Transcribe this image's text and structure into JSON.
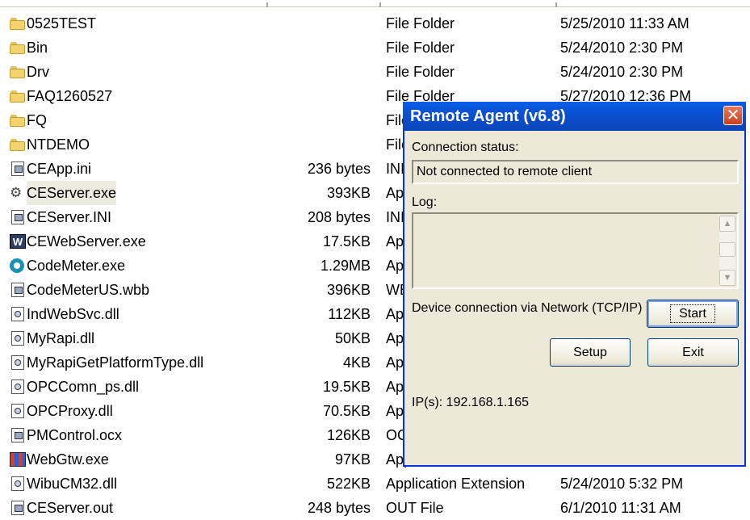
{
  "files": [
    {
      "icon": "folder-icon",
      "name": "0525TEST",
      "size": "",
      "type": "File Folder",
      "date": "5/25/2010 11:33 AM"
    },
    {
      "icon": "folder-icon",
      "name": "Bin",
      "size": "",
      "type": "File Folder",
      "date": "5/24/2010 2:30 PM"
    },
    {
      "icon": "folder-icon",
      "name": "Drv",
      "size": "",
      "type": "File Folder",
      "date": "5/24/2010 2:30 PM"
    },
    {
      "icon": "folder-icon",
      "name": "FAQ1260527",
      "size": "",
      "type": "File Folder",
      "date": "5/27/2010 12:36 PM"
    },
    {
      "icon": "folder-icon",
      "name": "FQ",
      "size": "",
      "type": "File Folder",
      "date": ""
    },
    {
      "icon": "folder-icon",
      "name": "NTDEMO",
      "size": "",
      "type": "File Folder",
      "date": ""
    },
    {
      "icon": "ini-file-icon",
      "name": "CEApp.ini",
      "size": "236 bytes",
      "type": "INI",
      "date": ""
    },
    {
      "icon": "gear-exe-icon",
      "name": "CEServer.exe",
      "size": "393KB",
      "type": "Application",
      "date": ""
    },
    {
      "icon": "ini-file-icon",
      "name": "CEServer.INI",
      "size": "208 bytes",
      "type": "INI",
      "date": ""
    },
    {
      "icon": "web-server-icon",
      "name": "CEWebServer.exe",
      "size": "17.5KB",
      "type": "Application",
      "date": ""
    },
    {
      "icon": "codemeter-icon",
      "name": "CodeMeter.exe",
      "size": "1.29MB",
      "type": "Application",
      "date": ""
    },
    {
      "icon": "wbb-file-icon",
      "name": "CodeMeterUS.wbb",
      "size": "396KB",
      "type": "WBB File",
      "date": ""
    },
    {
      "icon": "dll-file-icon",
      "name": "IndWebSvc.dll",
      "size": "112KB",
      "type": "Application Extension",
      "date": ""
    },
    {
      "icon": "dll-file-icon",
      "name": "MyRapi.dll",
      "size": "50KB",
      "type": "Application Extension",
      "date": ""
    },
    {
      "icon": "dll-file-icon",
      "name": "MyRapiGetPlatformType.dll",
      "size": "4KB",
      "type": "Application Extension",
      "date": ""
    },
    {
      "icon": "dll-file-icon",
      "name": "OPCComn_ps.dll",
      "size": "19.5KB",
      "type": "Application Extension",
      "date": ""
    },
    {
      "icon": "dll-file-icon",
      "name": "OPCProxy.dll",
      "size": "70.5KB",
      "type": "Application Extension",
      "date": ""
    },
    {
      "icon": "ocx-file-icon",
      "name": "PMControl.ocx",
      "size": "126KB",
      "type": "OCX File",
      "date": ""
    },
    {
      "icon": "webgtw-exe-icon",
      "name": "WebGtw.exe",
      "size": "97KB",
      "type": "Application",
      "date": ""
    },
    {
      "icon": "dll-file-icon",
      "name": "WibuCM32.dll",
      "size": "522KB",
      "type": "Application Extension",
      "date": "5/24/2010 5:32 PM"
    },
    {
      "icon": "out-file-icon",
      "name": "CEServer.out",
      "size": "248 bytes",
      "type": "OUT File",
      "date": "6/1/2010 11:31 AM"
    }
  ],
  "dialog": {
    "title": "Remote Agent (v6.8)",
    "close_glyph": "✕",
    "connection_status_label": "Connection status:",
    "connection_status_value": "Not connected to remote client",
    "log_label": "Log:",
    "device_connection_text": "Device connection via Network (TCP/IP)",
    "start_label": "Start",
    "setup_label": "Setup",
    "exit_label": "Exit",
    "ip_text": "IP(s): 192.168.1.165"
  },
  "colors": {
    "titlebar": "#0a5de8",
    "dialog_bg": "#ece9d8",
    "close_button": "#d9522e"
  }
}
